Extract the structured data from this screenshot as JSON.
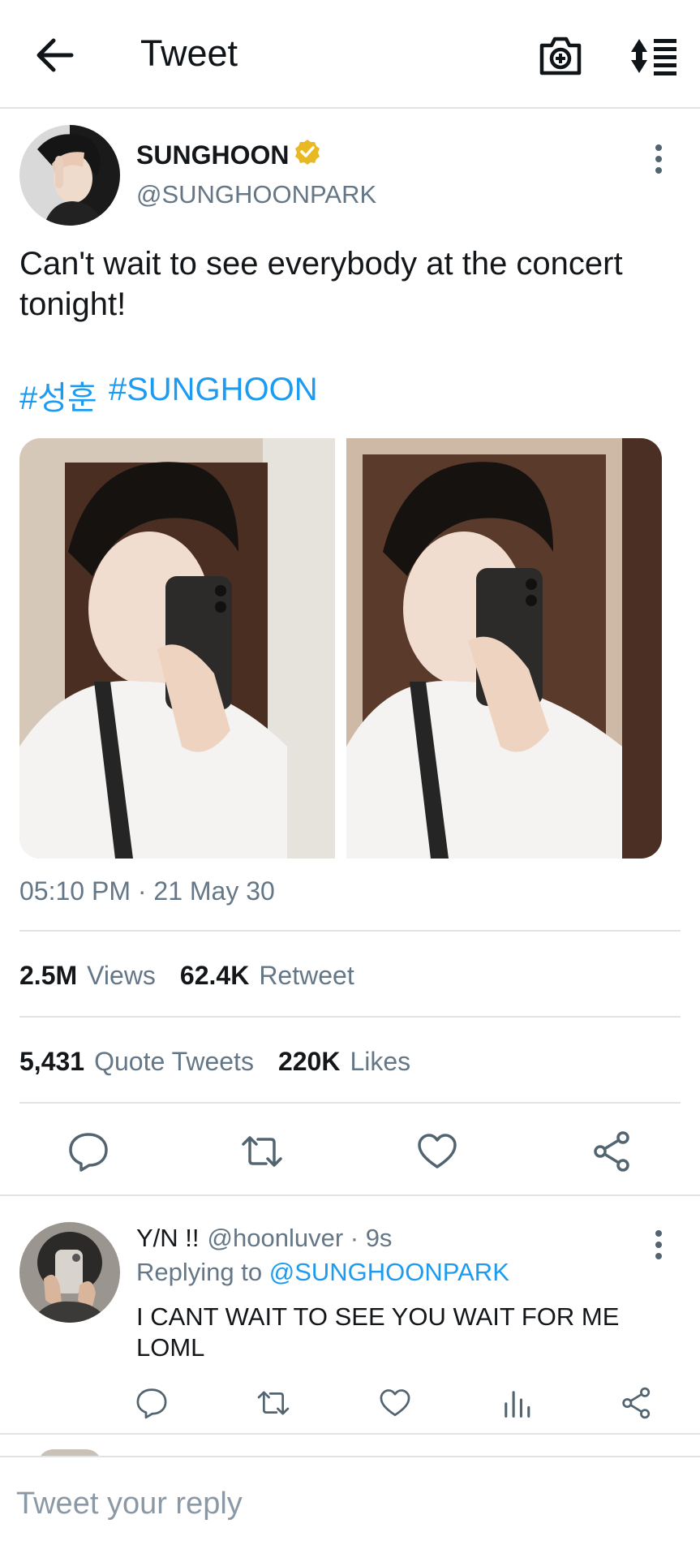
{
  "header": {
    "title": "Tweet"
  },
  "tweet": {
    "author_name": "SUNGHOON",
    "handle": "@SUNGHOONPARK",
    "text": "Can't wait to see everybody at the concert tonight!",
    "hashtags": [
      "#성훈",
      "#SUNGHOON"
    ],
    "timestamp": "05:10 PM · 21 May 30",
    "stats": {
      "views_value": "2.5M",
      "views_label": "Views",
      "retweets_value": "62.4K",
      "retweets_label": "Retweet",
      "quotes_value": "5,431",
      "quotes_label": "Quote Tweets",
      "likes_value": "220K",
      "likes_label": "Likes"
    }
  },
  "reply": {
    "name": "Y/N !!",
    "meta": "@hoonluver · 9s",
    "replying_prefix": "Replying to",
    "replying_handle": "@SUNGHOONPARK",
    "text": "I CANT WAIT TO SEE YOU WAIT FOR ME LOML"
  },
  "composer": {
    "placeholder": "Tweet your reply"
  },
  "colors": {
    "link": "#1d9bf0",
    "muted": "#657786",
    "verified": "#e8b923"
  },
  "icons": [
    "back-arrow-icon",
    "camera-add-icon",
    "sort-icon",
    "verified-badge-icon",
    "more-vertical-icon",
    "reply-icon",
    "retweet-icon",
    "like-icon",
    "share-icon",
    "analytics-icon"
  ]
}
